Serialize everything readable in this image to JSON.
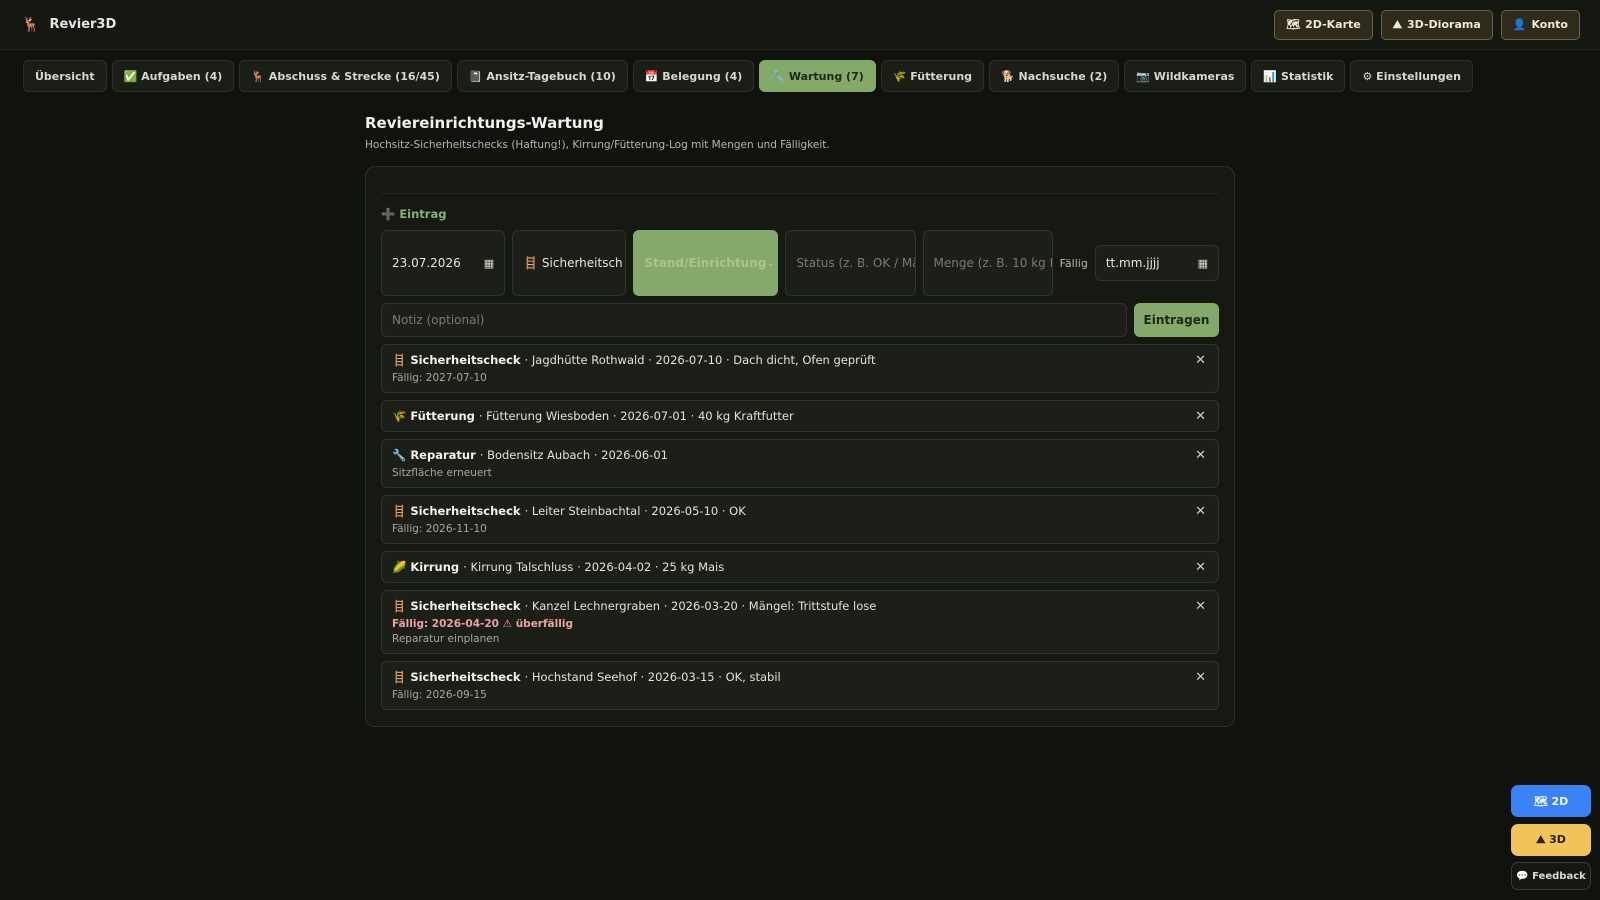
{
  "app": {
    "title": "Revier3D",
    "logo": "🦌"
  },
  "top_actions": [
    {
      "icon": "🗺",
      "label": "2D-Karte"
    },
    {
      "icon": "⛰",
      "label": "3D-Diorama"
    },
    {
      "icon": "👤",
      "label": "Konto"
    }
  ],
  "tabs": [
    {
      "label": "Übersicht"
    },
    {
      "label": "✅ Aufgaben (4)"
    },
    {
      "label": "🦌 Abschuss & Strecke (16/45)"
    },
    {
      "label": "📓 Ansitz-Tagebuch (10)"
    },
    {
      "label": "📅 Belegung (4)"
    },
    {
      "label": "🔧 Wartung (7)",
      "active": true
    },
    {
      "label": "🌾 Fütterung"
    },
    {
      "label": "🐕 Nachsuche (2)"
    },
    {
      "label": "📷 Wildkameras"
    },
    {
      "label": "📊 Statistik"
    },
    {
      "label": "⚙ Einstellungen"
    }
  ],
  "page": {
    "title": "Reviereinrichtungs-Wartung",
    "subtitle": "Hochsitz-Sicherheitschecks (Haftung!), Kirrung/Fütterung-Log mit Mengen und Fälligkeit."
  },
  "form": {
    "heading": "➕ Eintrag",
    "date_value": "23.07.2026",
    "type_value": "🪜 Sicherheitsch",
    "stand_placeholder": "Stand/Einrichtung",
    "status_placeholder": "Status (z. B. OK / Mä",
    "amount_placeholder": "Menge (z. B. 10 kg M",
    "due_label": "Fällig",
    "due_value": "tt.mm.jjjj",
    "note_placeholder": "Notiz (optional)",
    "submit_label": "Eintragen"
  },
  "entries": [
    {
      "icon": "🪜",
      "type": "Sicherheitscheck",
      "details": "· Jagdhütte Rothwald · 2026-07-10 · Dach dicht, Ofen geprüft",
      "lines": [
        {
          "text": "Fällig: 2027-07-10",
          "overdue": false
        }
      ]
    },
    {
      "icon": "🌾",
      "type": "Fütterung",
      "details": "· Fütterung Wiesboden · 2026-07-01 · 40 kg Kraftfutter",
      "lines": []
    },
    {
      "icon": "🔧",
      "type": "Reparatur",
      "details": "· Bodensitz Aubach · 2026-06-01",
      "lines": [
        {
          "text": "Sitzfläche erneuert",
          "overdue": false
        }
      ]
    },
    {
      "icon": "🪜",
      "type": "Sicherheitscheck",
      "details": "· Leiter Steinbachtal · 2026-05-10 · OK",
      "lines": [
        {
          "text": "Fällig: 2026-11-10",
          "overdue": false
        }
      ]
    },
    {
      "icon": "🌽",
      "type": "Kirrung",
      "details": "· Kirrung Talschluss · 2026-04-02 · 25 kg Mais",
      "lines": []
    },
    {
      "icon": "🪜",
      "type": "Sicherheitscheck",
      "details": "· Kanzel Lechnergraben · 2026-03-20 · Mängel: Trittstufe lose",
      "lines": [
        {
          "text": "Fällig: 2026-04-20 ⚠ überfällig",
          "overdue": true
        },
        {
          "text": "Reparatur einplanen",
          "overdue": false
        }
      ]
    },
    {
      "icon": "🪜",
      "type": "Sicherheitscheck",
      "details": "· Hochstand Seehof · 2026-03-15 · OK, stabil",
      "lines": [
        {
          "text": "Fällig: 2026-09-15",
          "overdue": false
        }
      ]
    }
  ],
  "close_glyph": "✕",
  "fabs": {
    "twod": "🗺 2D",
    "threed": "⛰ 3D",
    "feedback": "💬 Feedback"
  },
  "colors": {
    "accent": "#85a96b",
    "bg": "#0f120d",
    "overdue": "#f0a0a0",
    "fab_2d": "#3b82f6",
    "fab_3d": "#f0c45a"
  }
}
